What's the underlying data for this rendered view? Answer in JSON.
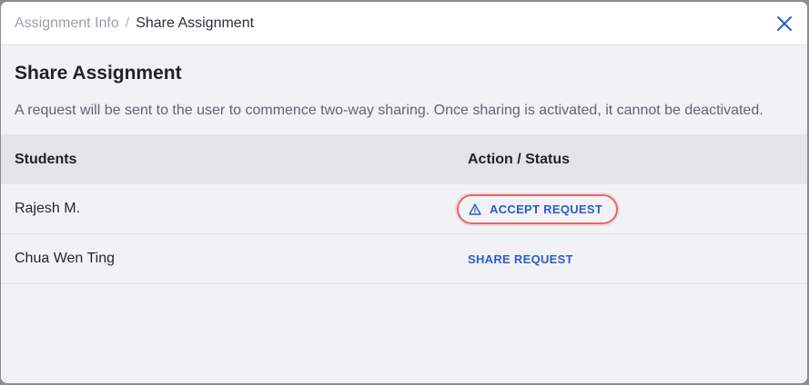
{
  "breadcrumb": {
    "parent": "Assignment Info",
    "separator": "/",
    "current": "Share Assignment"
  },
  "title": "Share Assignment",
  "description": "A request will be sent to the user to commence two-way sharing. Once sharing is activated, it cannot be deactivated.",
  "table": {
    "columns": [
      "Students",
      "Action / Status"
    ],
    "rows": [
      {
        "student": "Rajesh M.",
        "action": "ACCEPT REQUEST",
        "icon": "warning-icon",
        "highlighted": true
      },
      {
        "student": "Chua Wen Ting",
        "action": "SHARE REQUEST",
        "highlighted": false
      }
    ]
  },
  "colors": {
    "accent": "#2f5bc4",
    "highlight": "#e06a6a",
    "close": "#2f5bc4"
  }
}
